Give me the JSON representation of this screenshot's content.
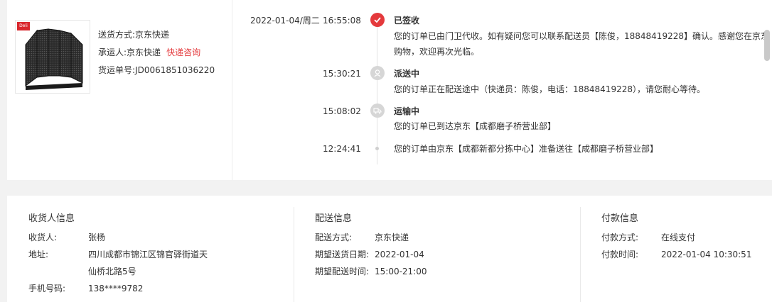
{
  "product": {
    "brand_label": "Deli",
    "ship_method_label": "送货方式:",
    "ship_method_value": "京东快递",
    "carrier_label": "承运人:",
    "carrier_value": "京东快递",
    "carrier_link": "快递咨询",
    "tracking_label": "货运单号:",
    "tracking_value": "JD0061851036220"
  },
  "timeline": [
    {
      "date": "2022-01-04/周二",
      "time": "16:55:08",
      "title": "已签收",
      "desc_line1": "您的订单已由门卫代收。如有疑问您可以联系配送员【陈俊，18848419228】确认。感谢您在京东",
      "desc_line2": "购物，欢迎再次光临。",
      "icon": "check-icon",
      "status_color": "#e4393c"
    },
    {
      "date": "",
      "time": "15:30:21",
      "title": "派送中",
      "desc_line1": "您的订单正在配送途中（快递员：陈俊，电话：18848419228），请您耐心等待。",
      "icon": "courier-icon"
    },
    {
      "date": "",
      "time": "15:08:02",
      "title": "运输中",
      "desc_line1": "您的订单已到达京东【成都磨子桥营业部】",
      "icon": "truck-icon"
    },
    {
      "date": "",
      "time": "12:24:41",
      "title": "",
      "desc_line1": "您的订单由京东【成都新都分拣中心】准备送往【成都磨子桥营业部】",
      "icon": "dot-icon"
    }
  ],
  "receiver": {
    "title": "收货人信息",
    "name_label": "收货人:",
    "name_value": "张杨",
    "address_label": "地址:",
    "address_line1": "四川成都市锦江区锦官驿街道天",
    "address_line2": "仙桥北路5号",
    "phone_label": "手机号码:",
    "phone_value": "138****9782"
  },
  "delivery": {
    "title": "配送信息",
    "method_label": "配送方式:",
    "method_value": "京东快递",
    "date_label": "期望送货日期:",
    "date_value": "2022-01-04",
    "time_label": "期望配送时间:",
    "time_value": "15:00-21:00"
  },
  "payment": {
    "title": "付款信息",
    "method_label": "付款方式:",
    "method_value": "在线支付",
    "time_label": "付款时间:",
    "time_value": "2022-01-04 10:30:51"
  }
}
